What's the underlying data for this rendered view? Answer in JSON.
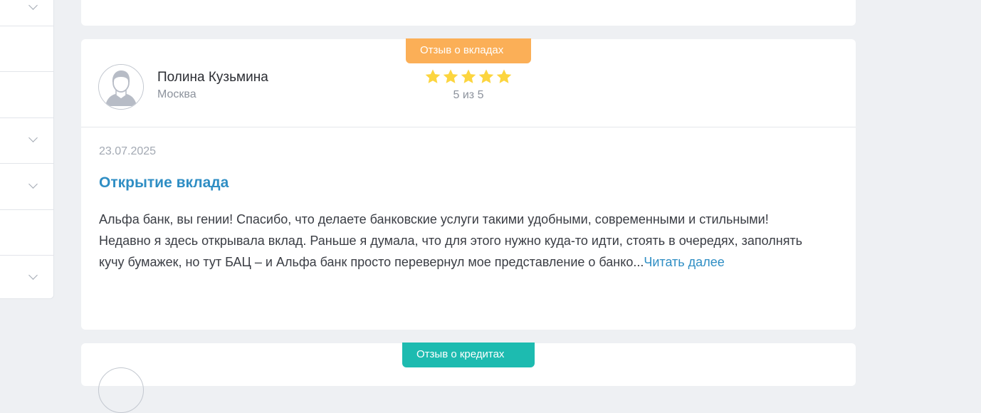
{
  "sidebar": {
    "rows": [
      {
        "chevron": true
      },
      {
        "chevron": false
      },
      {
        "chevron": false
      },
      {
        "chevron": true
      },
      {
        "chevron": true
      },
      {
        "chevron": false
      },
      {
        "chevron": true
      }
    ]
  },
  "review": {
    "category_tag": "Отзыв о вкладах",
    "author": {
      "name": "Полина Кузьмина",
      "city": "Москва",
      "avatar_icon": "user-avatar-icon"
    },
    "rating": {
      "value": 5,
      "max": 5,
      "label": "5 из 5",
      "star_color": "#fcd53f"
    },
    "date": "23.07.2025",
    "title": "Открытие вклада",
    "text": "Альфа банк, вы гении! Спасибо, что делаете банковские услуги такими удобными, современными и стильными! Недавно я здесь открывала вклад. Раньше я думала, что для этого нужно куда-то идти, стоять в очередях, заполнять кучу бумажек, но тут БАЦ – и Альфа банк просто перевернул мое представление о банко...",
    "read_more_label": "Читать далее"
  },
  "next_review": {
    "category_tag": "Отзыв о кредитах"
  },
  "colors": {
    "page_bg": "#eef0f3",
    "deposit_tag": "#fbaf57",
    "credit_tag": "#1dbbb0",
    "link": "#2f8ec4"
  }
}
